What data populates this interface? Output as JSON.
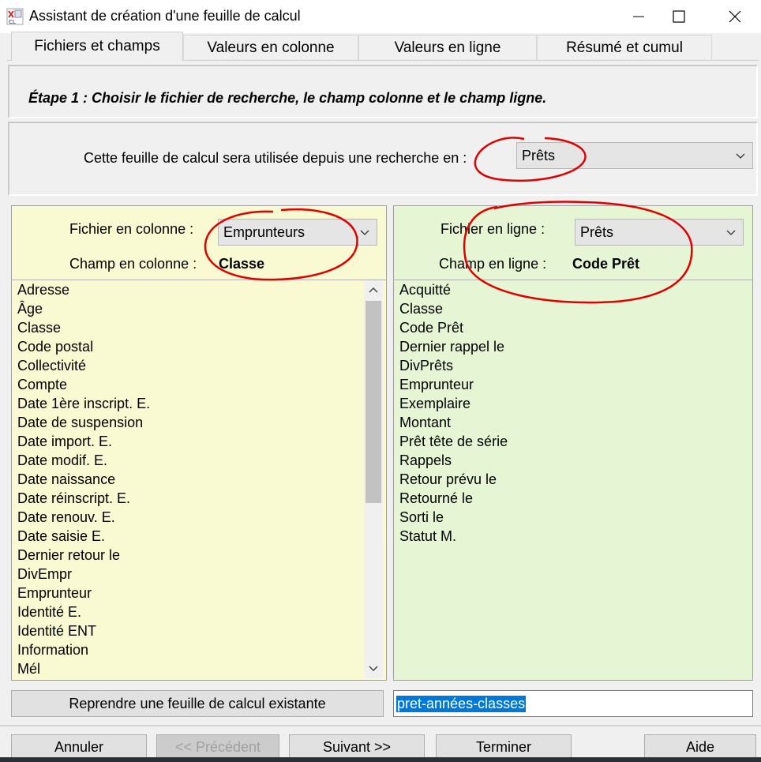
{
  "window": {
    "title": "Assistant de création d'une feuille de calcul",
    "minimize_glyph": "—",
    "maximize_glyph": "☐",
    "close_glyph": "✕"
  },
  "tabs": [
    {
      "label": "Fichiers et champs",
      "active": true
    },
    {
      "label": "Valeurs en colonne",
      "active": false
    },
    {
      "label": "Valeurs en ligne",
      "active": false
    },
    {
      "label": "Résumé et cumul",
      "active": false
    }
  ],
  "step": {
    "text": "Étape 1 :  Choisir le fichier de recherche, le champ colonne et le champ ligne."
  },
  "search": {
    "label": "Cette feuille de calcul sera utilisée depuis une recherche en :",
    "selected": "Prêts"
  },
  "left_panel": {
    "file_label": "Fichier en colonne :",
    "file_selected": "Emprunteurs",
    "field_label": "Champ en colonne :",
    "field_value": "Classe",
    "items": [
      "Adresse",
      "Âge",
      "Classe",
      "Code postal",
      "Collectivité",
      "Compte",
      "Date 1ère inscript. E.",
      "Date de suspension",
      "Date import. E.",
      "Date modif. E.",
      "Date naissance",
      "Date réinscript. E.",
      "Date renouv. E.",
      "Date saisie E.",
      "Dernier retour le",
      "DivEmpr",
      "Emprunteur",
      "Identité E.",
      "Identité ENT",
      "Information",
      "Mél"
    ]
  },
  "right_panel": {
    "file_label": "Fichier en ligne :",
    "file_selected": "Prêts",
    "field_label": "Champ en ligne :",
    "field_value": "Code Prêt",
    "items": [
      "Acquitté",
      "Classe",
      "Code Prêt",
      "Dernier rappel le",
      "DivPrêts",
      "Emprunteur",
      "Exemplaire",
      "Montant",
      "Prêt tête de série",
      "Rappels",
      "Retour prévu le",
      "Retourné le",
      "Sorti le",
      "Statut M."
    ]
  },
  "resume_button": "Reprendre une feuille de calcul existante",
  "sheet_name": "pret-années-classes",
  "footer": {
    "cancel": "Annuler",
    "previous": "<< Précédent",
    "next": "Suivant >>",
    "finish": "Terminer",
    "help": "Aide"
  },
  "colors": {
    "left_panel_bg": "#fafad2",
    "right_panel_bg": "#e6f5d4",
    "selection": "#0078d7",
    "annotation": "#e00000"
  }
}
